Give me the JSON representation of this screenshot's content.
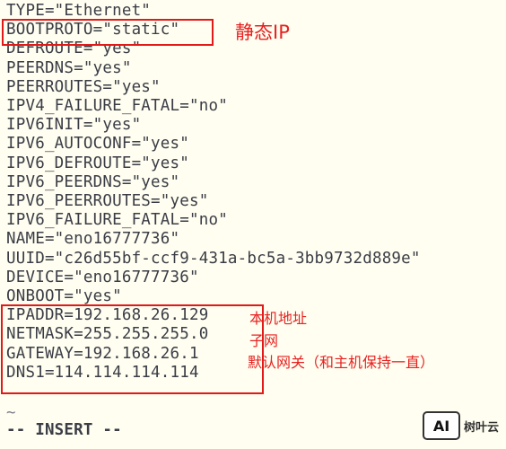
{
  "editor": {
    "lines": [
      "TYPE=\"Ethernet\"",
      "BOOTPROTO=\"static\"",
      "DEFROUTE=\"yes\"",
      "PEERDNS=\"yes\"",
      "PEERROUTES=\"yes\"",
      "IPV4_FAILURE_FATAL=\"no\"",
      "IPV6INIT=\"yes\"",
      "IPV6_AUTOCONF=\"yes\"",
      "IPV6_DEFROUTE=\"yes\"",
      "IPV6_PEERDNS=\"yes\"",
      "IPV6_PEERROUTES=\"yes\"",
      "IPV6_FAILURE_FATAL=\"no\"",
      "NAME=\"eno16777736\"",
      "UUID=\"c26d55bf-ccf9-431a-bc5a-3bb9732d889e\"",
      "DEVICE=\"eno16777736\"",
      "ONBOOT=\"yes\"",
      "IPADDR=192.168.26.129",
      "NETMASK=255.255.255.0",
      "GATEWAY=192.168.26.1",
      "DNS1=114.114.114.114"
    ],
    "tilde": "~",
    "mode": "-- INSERT --"
  },
  "annotations": {
    "static_ip": "静态IP",
    "ip_address": "本机地址",
    "subnet": "子网",
    "gateway": "默认网关（和主机保持一直）"
  },
  "colors": {
    "background": "#fffef0",
    "text": "#3a3d46",
    "annotation": "#e62222"
  },
  "watermark": {
    "logo": "AI",
    "text": "树叶云"
  }
}
